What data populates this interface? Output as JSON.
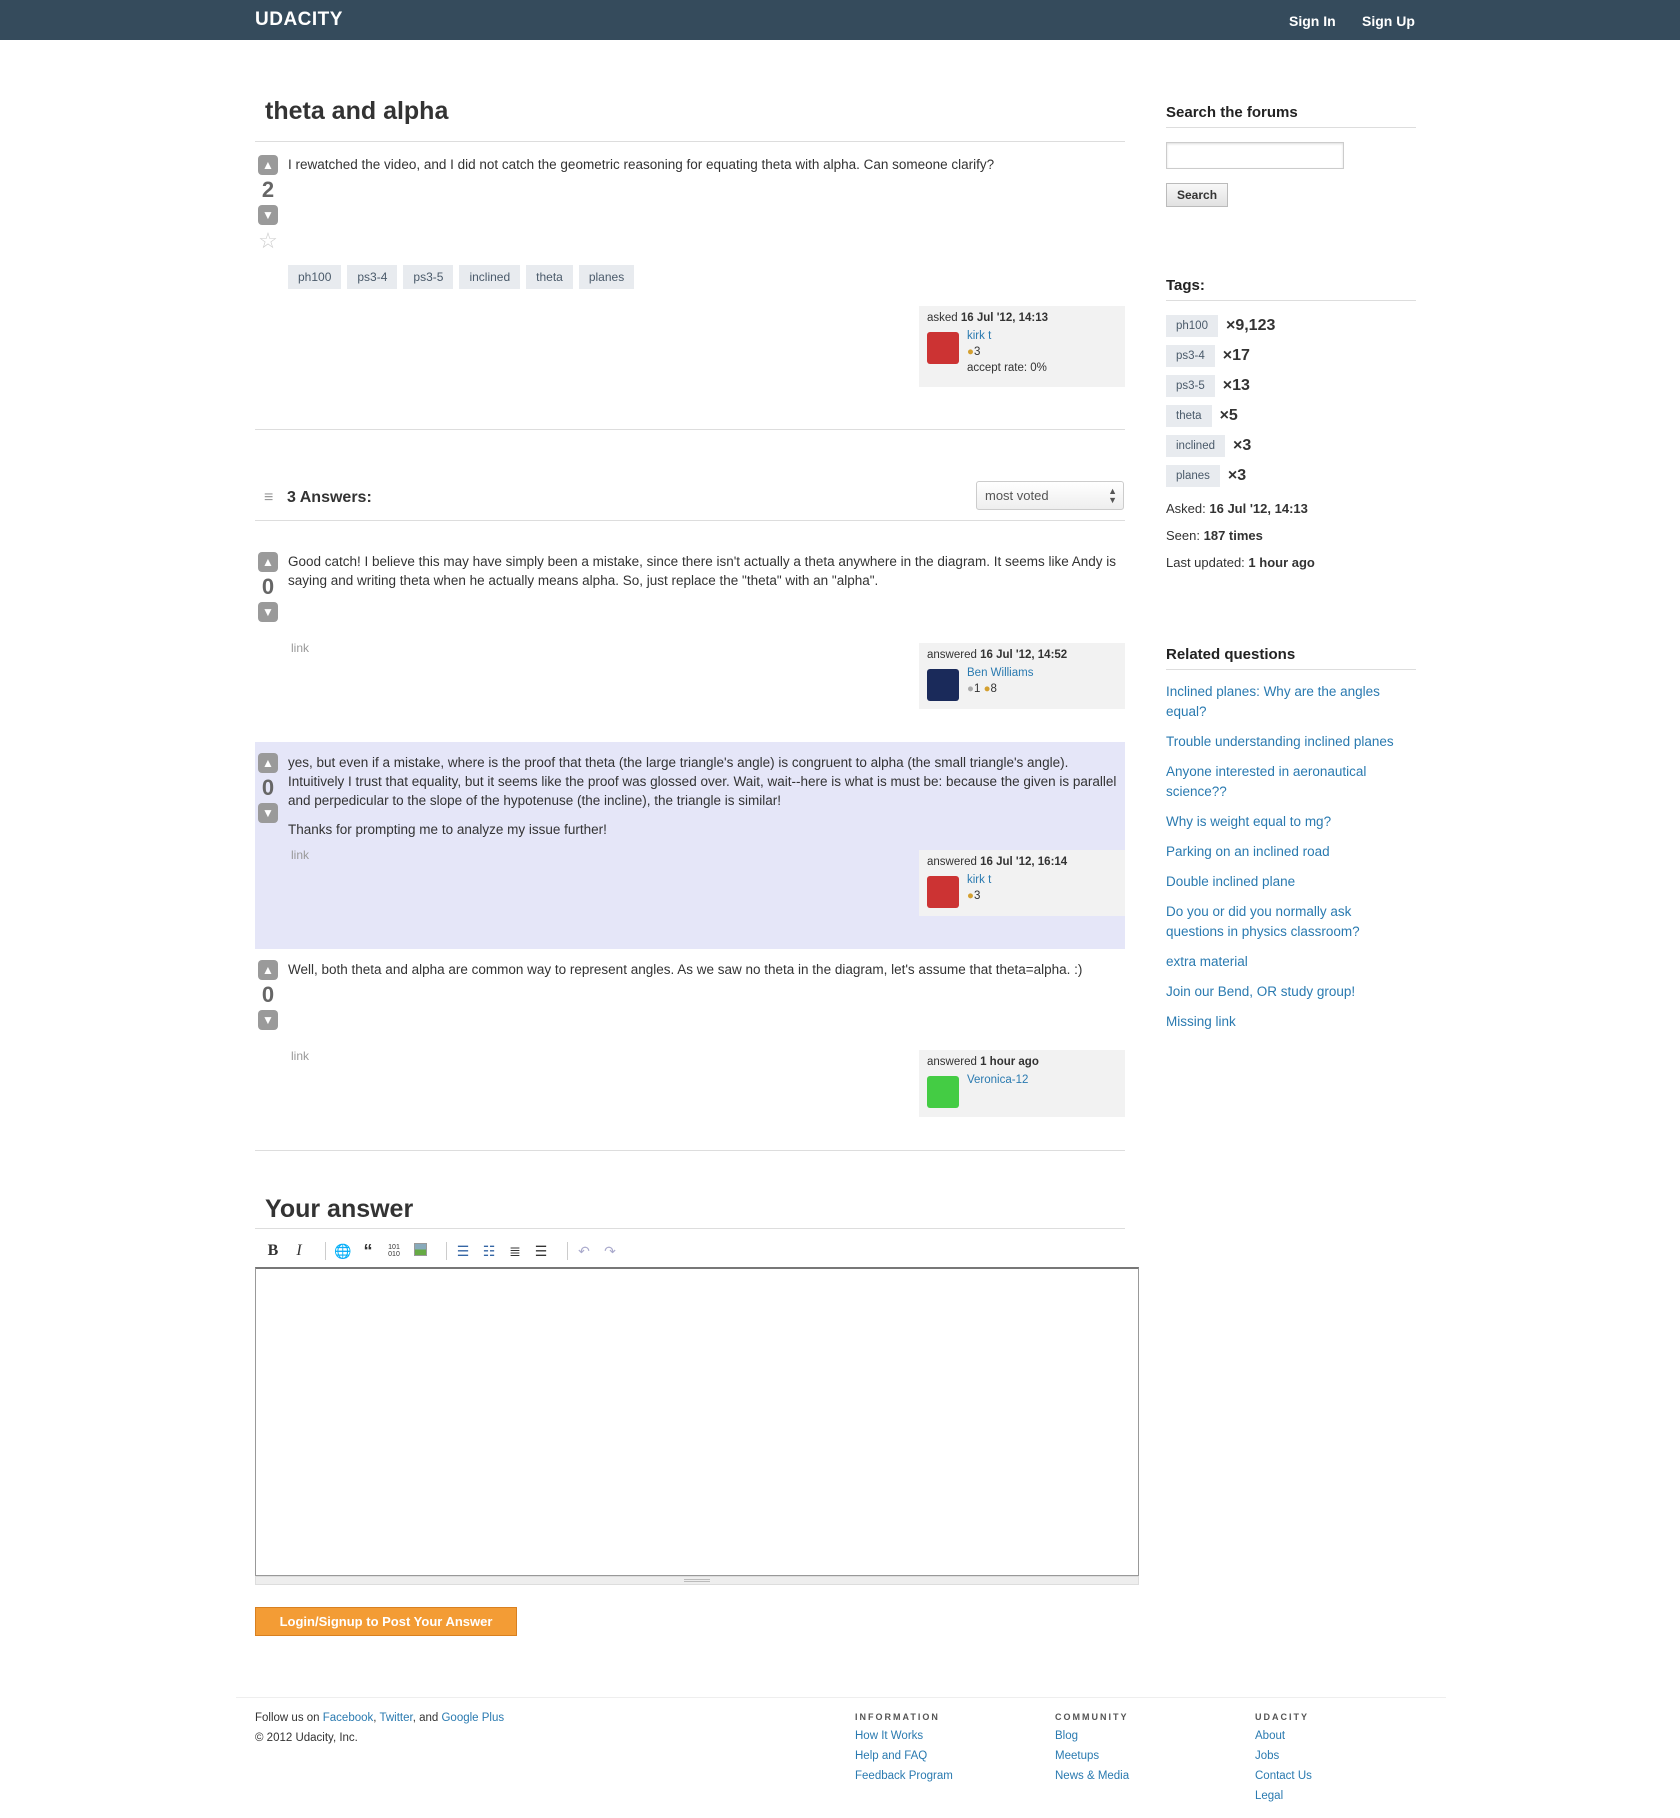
{
  "header": {
    "logo": "UDACITY",
    "sign_in": "Sign In",
    "sign_up": "Sign Up"
  },
  "question": {
    "title": "theta and alpha",
    "body": "I rewatched the video, and I did not catch the geometric reasoning for equating theta with alpha. Can someone clarify?",
    "votes": "2",
    "tags": [
      "ph100",
      "ps3-4",
      "ps3-5",
      "inclined",
      "theta",
      "planes"
    ],
    "asked_label": "asked",
    "asked_date": "16 Jul '12, 14:13",
    "user": "kirk t",
    "rep": "3",
    "accept_rate": "accept rate: 0%"
  },
  "answers_header": {
    "title": "3 Answers:",
    "sort": "most voted"
  },
  "answers": [
    {
      "body": "Good catch! I believe this may have simply been a mistake, since there isn't actually a theta anywhere in the diagram. It seems like Andy is saying and writing theta when he actually means alpha. So, just replace the \"theta\" with an \"alpha\".",
      "votes": "0",
      "link": "link",
      "answered_label": "answered",
      "date": "16 Jul '12, 14:52",
      "user": "Ben Williams",
      "badges1": "1",
      "badges2": "8"
    },
    {
      "body": "yes, but even if a mistake, where is the proof that theta (the large triangle's angle) is congruent to alpha (the small triangle's angle). Intuitively I trust that equality, but it seems like the proof was glossed over. Wait, wait--here is what is must be: because the given is parallel and perpedicular to the slope of the hypotenuse (the incline), the triangle is similar!",
      "body2": "Thanks for prompting me to analyze my issue further!",
      "votes": "0",
      "link": "link",
      "answered_label": "answered",
      "date": "16 Jul '12, 16:14",
      "user": "kirk t",
      "badges2": "3"
    },
    {
      "body": "Well, both theta and alpha are common way to represent angles. As we saw no theta in the diagram, let's assume that theta=alpha. :)",
      "votes": "0",
      "link": "link",
      "answered_label": "answered",
      "date": "1 hour ago",
      "user": "Veronica-12"
    }
  ],
  "your_answer": {
    "title": "Your answer",
    "submit": "Login/Signup to Post Your Answer"
  },
  "sidebar": {
    "search_title": "Search the forums",
    "search_button": "Search",
    "tags_title": "Tags:",
    "tags": [
      {
        "name": "ph100",
        "count": "×9,123"
      },
      {
        "name": "ps3-4",
        "count": "×17"
      },
      {
        "name": "ps3-5",
        "count": "×13"
      },
      {
        "name": "theta",
        "count": "×5"
      },
      {
        "name": "inclined",
        "count": "×3"
      },
      {
        "name": "planes",
        "count": "×3"
      }
    ],
    "asked_label": "Asked:",
    "asked": "16 Jul '12, 14:13",
    "seen_label": "Seen:",
    "seen": "187 times",
    "updated_label": "Last updated:",
    "updated": "1 hour ago",
    "related_title": "Related questions",
    "related": [
      "Inclined planes: Why are the angles equal?",
      "Trouble understanding inclined planes",
      "Anyone interested in aeronautical science??",
      "Why is weight equal to mg?",
      "Parking on an inclined road",
      "Double inclined plane",
      "Do you or did you normally ask questions in physics classroom?",
      "extra material",
      "Join our Bend, OR study group!",
      "Missing link"
    ]
  },
  "footer": {
    "follow": "Follow us on",
    "facebook": "Facebook",
    "twitter": "Twitter",
    "and": "and",
    "google": "Google Plus",
    "copyright": "© 2012 Udacity, Inc.",
    "info_title": "INFORMATION",
    "info": [
      "How It Works",
      "Help and FAQ",
      "Feedback Program"
    ],
    "community_title": "COMMUNITY",
    "community": [
      "Blog",
      "Meetups",
      "News & Media"
    ],
    "udacity_title": "UDACITY",
    "udacity": [
      "About",
      "Jobs",
      "Contact Us",
      "Legal"
    ]
  }
}
